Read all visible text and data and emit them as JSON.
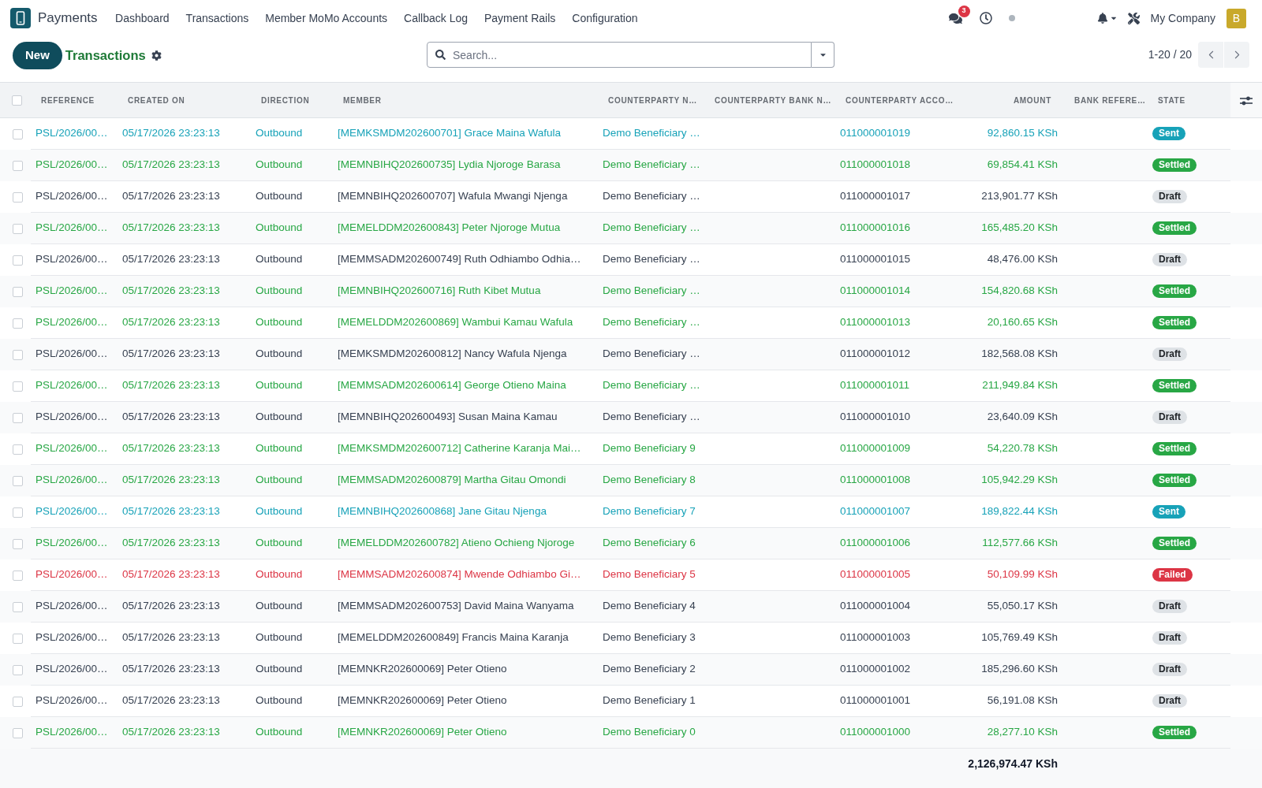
{
  "navbar": {
    "app_name": "Payments",
    "menu": [
      "Dashboard",
      "Transactions",
      "Member MoMo Accounts",
      "Callback Log",
      "Payment Rails",
      "Configuration"
    ],
    "unread_messages": "3",
    "company": "My Company",
    "avatar_letter": "B"
  },
  "control_panel": {
    "new_button": "New",
    "title": "Transactions",
    "search": {
      "placeholder": "Search..."
    },
    "pager": "1-20 / 20"
  },
  "table": {
    "all_selected": false,
    "columns": [
      {
        "label": "REFERENCE",
        "kind": "text"
      },
      {
        "label": "CREATED ON",
        "kind": "text"
      },
      {
        "label": "DIRECTION",
        "kind": "text"
      },
      {
        "label": "MEMBER",
        "kind": "text"
      },
      {
        "label": "COUNTERPARTY N…",
        "kind": "text"
      },
      {
        "label": "COUNTERPARTY BANK N…",
        "kind": "text"
      },
      {
        "label": "COUNTERPARTY ACCO…",
        "kind": "text"
      },
      {
        "label": "AMOUNT",
        "kind": "number"
      },
      {
        "label": "BANK REFERE…",
        "kind": "text"
      },
      {
        "label": "STATE",
        "kind": "text"
      }
    ],
    "rows": [
      {
        "reference": "PSL/2026/00…",
        "created_on": "05/17/2026 23:23:13",
        "direction": "Outbound",
        "member": "[MEMKSMDM202600701] Grace Maina Wafula",
        "counterparty_name": "Demo Beneficiary …",
        "counterparty_account": "011000001019",
        "amount": "92,860.15 KSh",
        "state": "Sent",
        "kind": "sent",
        "selected": false
      },
      {
        "reference": "PSL/2026/00…",
        "created_on": "05/17/2026 23:23:13",
        "direction": "Outbound",
        "member": "[MEMNBIHQ202600735] Lydia Njoroge Barasa",
        "counterparty_name": "Demo Beneficiary …",
        "counterparty_account": "011000001018",
        "amount": "69,854.41 KSh",
        "state": "Settled",
        "kind": "settled",
        "selected": false
      },
      {
        "reference": "PSL/2026/00…",
        "created_on": "05/17/2026 23:23:13",
        "direction": "Outbound",
        "member": "[MEMNBIHQ202600707] Wafula Mwangi Njenga",
        "counterparty_name": "Demo Beneficiary …",
        "counterparty_account": "011000001017",
        "amount": "213,901.77 KSh",
        "state": "Draft",
        "kind": "draft",
        "selected": false
      },
      {
        "reference": "PSL/2026/00…",
        "created_on": "05/17/2026 23:23:13",
        "direction": "Outbound",
        "member": "[MEMELDDM202600843] Peter Njoroge Mutua",
        "counterparty_name": "Demo Beneficiary …",
        "counterparty_account": "011000001016",
        "amount": "165,485.20 KSh",
        "state": "Settled",
        "kind": "settled",
        "selected": false
      },
      {
        "reference": "PSL/2026/00…",
        "created_on": "05/17/2026 23:23:13",
        "direction": "Outbound",
        "member": "[MEMMSADM202600749] Ruth Odhiambo Odhia…",
        "counterparty_name": "Demo Beneficiary …",
        "counterparty_account": "011000001015",
        "amount": "48,476.00 KSh",
        "state": "Draft",
        "kind": "draft",
        "selected": false
      },
      {
        "reference": "PSL/2026/00…",
        "created_on": "05/17/2026 23:23:13",
        "direction": "Outbound",
        "member": "[MEMNBIHQ202600716] Ruth Kibet Mutua",
        "counterparty_name": "Demo Beneficiary …",
        "counterparty_account": "011000001014",
        "amount": "154,820.68 KSh",
        "state": "Settled",
        "kind": "settled",
        "selected": false
      },
      {
        "reference": "PSL/2026/00…",
        "created_on": "05/17/2026 23:23:13",
        "direction": "Outbound",
        "member": "[MEMELDDM202600869] Wambui Kamau Wafula",
        "counterparty_name": "Demo Beneficiary …",
        "counterparty_account": "011000001013",
        "amount": "20,160.65 KSh",
        "state": "Settled",
        "kind": "settled",
        "selected": false
      },
      {
        "reference": "PSL/2026/00…",
        "created_on": "05/17/2026 23:23:13",
        "direction": "Outbound",
        "member": "[MEMKSMDM202600812] Nancy Wafula Njenga",
        "counterparty_name": "Demo Beneficiary …",
        "counterparty_account": "011000001012",
        "amount": "182,568.08 KSh",
        "state": "Draft",
        "kind": "draft",
        "selected": false
      },
      {
        "reference": "PSL/2026/00…",
        "created_on": "05/17/2026 23:23:13",
        "direction": "Outbound",
        "member": "[MEMMSADM202600614] George Otieno Maina",
        "counterparty_name": "Demo Beneficiary …",
        "counterparty_account": "011000001011",
        "amount": "211,949.84 KSh",
        "state": "Settled",
        "kind": "settled",
        "selected": false
      },
      {
        "reference": "PSL/2026/00…",
        "created_on": "05/17/2026 23:23:13",
        "direction": "Outbound",
        "member": "[MEMNBIHQ202600493] Susan Maina Kamau",
        "counterparty_name": "Demo Beneficiary …",
        "counterparty_account": "011000001010",
        "amount": "23,640.09 KSh",
        "state": "Draft",
        "kind": "draft",
        "selected": false
      },
      {
        "reference": "PSL/2026/00…",
        "created_on": "05/17/2026 23:23:13",
        "direction": "Outbound",
        "member": "[MEMKSMDM202600712] Catherine Karanja Mai…",
        "counterparty_name": "Demo Beneficiary 9",
        "counterparty_account": "011000001009",
        "amount": "54,220.78 KSh",
        "state": "Settled",
        "kind": "settled",
        "selected": false
      },
      {
        "reference": "PSL/2026/00…",
        "created_on": "05/17/2026 23:23:13",
        "direction": "Outbound",
        "member": "[MEMMSADM202600879] Martha Gitau Omondi",
        "counterparty_name": "Demo Beneficiary 8",
        "counterparty_account": "011000001008",
        "amount": "105,942.29 KSh",
        "state": "Settled",
        "kind": "settled",
        "selected": false
      },
      {
        "reference": "PSL/2026/00…",
        "created_on": "05/17/2026 23:23:13",
        "direction": "Outbound",
        "member": "[MEMNBIHQ202600868] Jane Gitau Njenga",
        "counterparty_name": "Demo Beneficiary 7",
        "counterparty_account": "011000001007",
        "amount": "189,822.44 KSh",
        "state": "Sent",
        "kind": "sent",
        "selected": false
      },
      {
        "reference": "PSL/2026/00…",
        "created_on": "05/17/2026 23:23:13",
        "direction": "Outbound",
        "member": "[MEMELDDM202600782] Atieno Ochieng Njoroge",
        "counterparty_name": "Demo Beneficiary 6",
        "counterparty_account": "011000001006",
        "amount": "112,577.66 KSh",
        "state": "Settled",
        "kind": "settled",
        "selected": false
      },
      {
        "reference": "PSL/2026/00…",
        "created_on": "05/17/2026 23:23:13",
        "direction": "Outbound",
        "member": "[MEMMSADM202600874] Mwende Odhiambo Gi…",
        "counterparty_name": "Demo Beneficiary 5",
        "counterparty_account": "011000001005",
        "amount": "50,109.99 KSh",
        "state": "Failed",
        "kind": "failed",
        "selected": false
      },
      {
        "reference": "PSL/2026/00…",
        "created_on": "05/17/2026 23:23:13",
        "direction": "Outbound",
        "member": "[MEMMSADM202600753] David Maina Wanyama",
        "counterparty_name": "Demo Beneficiary 4",
        "counterparty_account": "011000001004",
        "amount": "55,050.17 KSh",
        "state": "Draft",
        "kind": "draft",
        "selected": false
      },
      {
        "reference": "PSL/2026/00…",
        "created_on": "05/17/2026 23:23:13",
        "direction": "Outbound",
        "member": "[MEMELDDM202600849] Francis Maina Karanja",
        "counterparty_name": "Demo Beneficiary 3",
        "counterparty_account": "011000001003",
        "amount": "105,769.49 KSh",
        "state": "Draft",
        "kind": "draft",
        "selected": false
      },
      {
        "reference": "PSL/2026/00…",
        "created_on": "05/17/2026 23:23:13",
        "direction": "Outbound",
        "member": "[MEMNKR202600069] Peter Otieno",
        "counterparty_name": "Demo Beneficiary 2",
        "counterparty_account": "011000001002",
        "amount": "185,296.60 KSh",
        "state": "Draft",
        "kind": "draft",
        "selected": false
      },
      {
        "reference": "PSL/2026/00…",
        "created_on": "05/17/2026 23:23:13",
        "direction": "Outbound",
        "member": "[MEMNKR202600069] Peter Otieno",
        "counterparty_name": "Demo Beneficiary 1",
        "counterparty_account": "011000001001",
        "amount": "56,191.08 KSh",
        "state": "Draft",
        "kind": "draft",
        "selected": false
      },
      {
        "reference": "PSL/2026/00…",
        "created_on": "05/17/2026 23:23:13",
        "direction": "Outbound",
        "member": "[MEMNKR202600069] Peter Otieno",
        "counterparty_name": "Demo Beneficiary 0",
        "counterparty_account": "011000001000",
        "amount": "28,277.10 KSh",
        "state": "Settled",
        "kind": "settled",
        "selected": false
      }
    ],
    "total": "2,126,974.47 KSh"
  }
}
